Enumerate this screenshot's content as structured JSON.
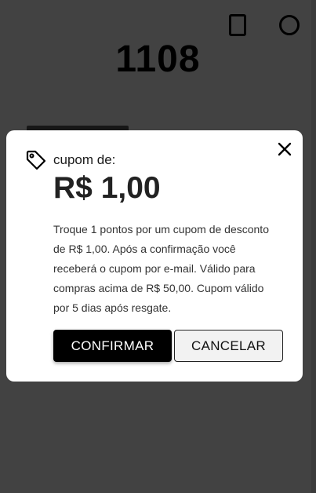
{
  "background": {
    "points_value": "1108"
  },
  "modal": {
    "coupon_label": "cupom de:",
    "coupon_value": "R$ 1,00",
    "description": "Troque 1 pontos por um cupom de desconto de R$ 1,00. Após a confirmação você receberá o cupom por e-mail. Válido para compras acima de R$ 50,00. Cupom válido por 5 dias após resgate.",
    "confirm_label": "CONFIRMAR",
    "cancel_label": "CANCELAR",
    "icons": {
      "tag": "tag-icon",
      "close": "close-icon"
    }
  },
  "colors": {
    "overlay": "rgba(0,0,0,0.72)",
    "confirm_bg": "#000000",
    "cancel_bg": "#f2f2f2"
  }
}
